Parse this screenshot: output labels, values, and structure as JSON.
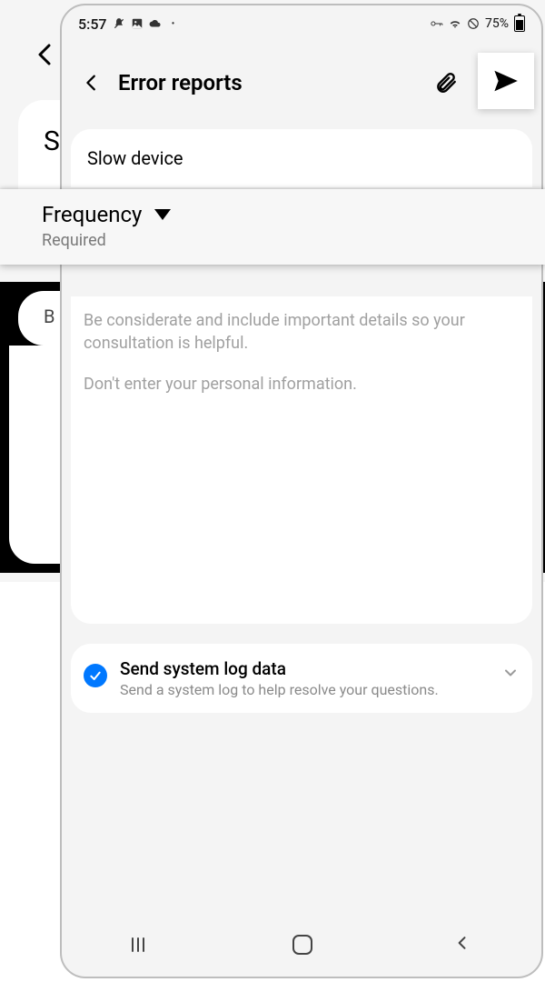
{
  "status": {
    "time": "5:57",
    "battery_pct": "75%"
  },
  "back_screen": {
    "letter_s": "S",
    "letter_b": "B"
  },
  "header": {
    "title": "Error reports"
  },
  "category": {
    "value": "Slow device"
  },
  "frequency": {
    "label": "Frequency",
    "hint": "Required"
  },
  "description": {
    "placeholder_line1": "Be considerate and include important details so your consultation is helpful.",
    "placeholder_line2": "Don't enter your personal information."
  },
  "syslog": {
    "checked": true,
    "title": "Send system log data",
    "subtitle": "Send a system log to help resolve your questions."
  }
}
